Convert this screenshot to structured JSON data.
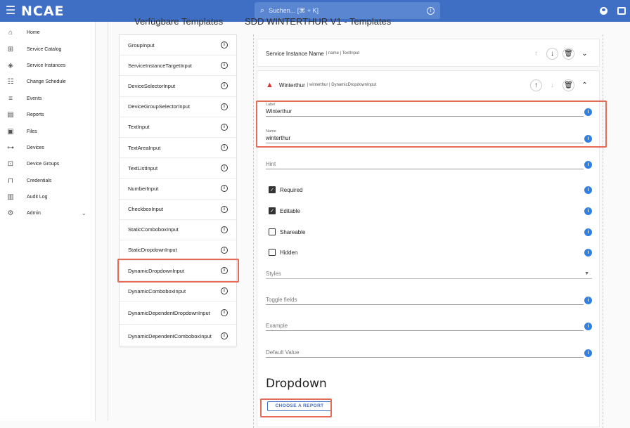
{
  "app": {
    "logo": "NCAE",
    "search_placeholder": "Suchen... [⌘ + K]"
  },
  "sidebar": {
    "items": [
      {
        "label": "Home",
        "icon": "home-icon",
        "glyph": "⌂"
      },
      {
        "label": "Service Catalog",
        "icon": "catalog-icon",
        "glyph": "⊞"
      },
      {
        "label": "Service Instances",
        "icon": "cube-icon",
        "glyph": "◈"
      },
      {
        "label": "Change Schedule",
        "icon": "schedule-icon",
        "glyph": "☷"
      },
      {
        "label": "Events",
        "icon": "events-icon",
        "glyph": "≡"
      },
      {
        "label": "Reports",
        "icon": "reports-icon",
        "glyph": "▤"
      },
      {
        "label": "Files",
        "icon": "files-icon",
        "glyph": "▣"
      },
      {
        "label": "Devices",
        "icon": "devices-icon",
        "glyph": "⊶"
      },
      {
        "label": "Device Groups",
        "icon": "device-groups-icon",
        "glyph": "⊡"
      },
      {
        "label": "Credentials",
        "icon": "lock-icon",
        "glyph": "⊓"
      },
      {
        "label": "Audit Log",
        "icon": "audit-log-icon",
        "glyph": "▥"
      },
      {
        "label": "Admin",
        "icon": "gear-icon",
        "glyph": "⚙",
        "chevron": "⌄"
      }
    ]
  },
  "headings": {
    "left": "Verfügbare Templates",
    "right": "SDD WINTERTHUR V1 - Templates"
  },
  "templates": [
    "GroupInput",
    "ServiceInstanceTargetInput",
    "DeviceSelectorInput",
    "DeviceGroupSelectorInput",
    "TextInput",
    "TextAreaInput",
    "TextListInput",
    "NumberInput",
    "CheckboxInput",
    "StaticComboboxInput",
    "StaticDropdownInput",
    "DynamicDropdownInput",
    "DynamicComboboxInput",
    "DynamicDependentDropdownInput",
    "DynamicDependentComboboxInput"
  ],
  "card1": {
    "title": "Service Instance Name",
    "meta": "| name | TextInput"
  },
  "card2": {
    "title": "Winterthur",
    "meta": "| winterthur | DynamicDropdownInput",
    "fields": {
      "label_label": "Label",
      "label_value": "Winterthur",
      "name_label": "Name",
      "name_value": "winterthur",
      "hint_placeholder": "Hint",
      "styles_placeholder": "Styles",
      "toggle_placeholder": "Toggle fields",
      "example_placeholder": "Example",
      "default_placeholder": "Default Value"
    },
    "checkboxes": {
      "required": "Required",
      "editable": "Editable",
      "shareable": "Shareable",
      "hidden": "Hidden"
    },
    "section_title": "Dropdown",
    "report_button": "CHOOSE A REPORT"
  },
  "colors": {
    "topbar": "#3f6fc4",
    "highlight": "#e56a57",
    "info_blue": "#2f80e6"
  }
}
